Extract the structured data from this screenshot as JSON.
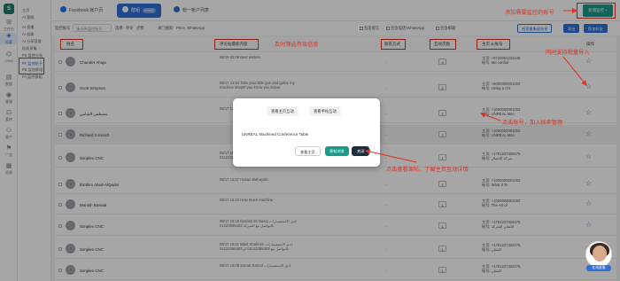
{
  "iconbar": {
    "logo_text": "S",
    "items": [
      {
        "glyph": "⊞",
        "label": "工作台"
      },
      {
        "glyph": "◈",
        "label": "拓客"
      },
      {
        "glyph": "⌬",
        "label": "CRM"
      },
      {
        "glyph": "▤",
        "label": "数据"
      },
      {
        "glyph": "◉",
        "label": "客服"
      },
      {
        "glyph": "⊡",
        "label": "素材"
      },
      {
        "glyph": "⚇",
        "label": "客户"
      },
      {
        "glyph": "⚑",
        "label": "广告"
      },
      {
        "glyph": "▦",
        "label": "资源"
      }
    ]
  },
  "subnav": {
    "items": [
      "主页",
      "AI 客服",
      "AI 直播",
      "AI 创建",
      "AI 分享获客",
      "挂机采集",
      "FB 监控分析",
      "FF 监控帖子",
      "FB 监控群组",
      "FA 监控群组"
    ]
  },
  "topbar": {
    "tabs": [
      {
        "label": "Facebook 帐户页",
        "color": "#1877f2",
        "badge": ""
      },
      {
        "label": "群组",
        "color": "#ffffff",
        "badge": "49897"
      },
      {
        "label": "粉一帐户列表",
        "color": "#2f6fd7",
        "badge": ""
      }
    ],
    "add_monitor": "新增监控 +"
  },
  "filterbar": {
    "label_account": "监控账号",
    "search_placeholder": "请选择监控账号",
    "tag1": "选择",
    "tag2": "评论",
    "tag3": "点赞",
    "label_keyword": "关门搜索",
    "keyword_value": "Price, WhatsApp",
    "check1": "包含留言",
    "check2": "包含电话/WhatsApp",
    "check3": "包含邮箱",
    "btn_collect": "线索量集成结果",
    "btn_export": "导出",
    "btn_batch": "群加好友"
  },
  "table": {
    "headers": [
      "姓名",
      "评论帖最新内容",
      "联系方式",
      "互动次数",
      "主页 & 帐号",
      "操作"
    ],
    "rows": [
      {
        "name": "Chander Ahuja",
        "time": "08/19 02:09 Best wishes",
        "contact": "-",
        "count": "3",
        "phone": "主页: +9720051332248\n帐号: Me.cordial",
        "grey": false
      },
      {
        "name": "Scott Simpson",
        "time": "08/17 21:53 Take your little gun and go!be my machine shop!If you know you know!",
        "contact": "-",
        "count": "2",
        "phone": "主页: +6000000001002\n帐号: Using a CN",
        "grey": false
      },
      {
        "name": "مصطفى الشامي",
        "time": "08/17 17:12 شكرا مساعدة للتعاون",
        "contact": "-",
        "count": "1",
        "phone": "主页: +1000000001002\n帐号: UNREAL Man",
        "grey": false
      },
      {
        "name": "Richard S Kirsch",
        "time": "",
        "contact": "-",
        "count": "2",
        "phone": "主页: +1000000001002\n帐号: UNREAL Man",
        "grey": true
      },
      {
        "name": "Simplex CNC",
        "time": "08/17 15:11 للاتصال\n01123355403 او 01223355403",
        "contact": "-",
        "count": "1",
        "phone": "主页: +1751227326475\n帐号: شركه الاتصال",
        "grey": false
      },
      {
        "name": "Ibrahim Abed-AlQader",
        "time": "08/17 15:07 Hasan Mahuydin",
        "contact": "-",
        "count": "1",
        "phone": "主页: +1000000001002\n帐号: What It To",
        "grey": false
      },
      {
        "name": "Manish Baswal",
        "time": "08/17 15:15 How much machine",
        "contact": "-",
        "count": "1",
        "phone": "主页: +1000000001002\n帐号: The Art of",
        "grey": false
      },
      {
        "name": "Simplex CNC",
        "time": "08/17 15:10 Ibrahim El-masry لدي الاستفسارات بالتواصل مع الشركة 01223355403",
        "contact": "-",
        "count": "1",
        "phone": "主页: +1751227326475\n帐号: اللتقان الشركة",
        "grey": false
      },
      {
        "name": "Simplex CNC",
        "time": "08/17 15:11 Wael Shaheen لدي الاستفسارات بالتواصل مع 01123355403 او 01223355403",
        "contact": "-",
        "count": "1",
        "phone": "主页: +1751227326475\n帐号: اللتقان",
        "grey": false
      },
      {
        "name": "Simplex CNC",
        "time": "08/17 15:08 Samar Kamal لدي الاستفسارات",
        "contact": "-",
        "count": "1",
        "phone": "主页: +1751227326475\n帐号: اللتقان",
        "grey": false
      }
    ]
  },
  "modal": {
    "tab1": "查看主页互动",
    "tab2": "查看手帖互动",
    "desc": "UNREAL Machined Conference Table",
    "btn_home": "查看主页",
    "btn_post": "原帖浏览",
    "btn_close": "关闭"
  },
  "annotations": {
    "add_account": "添加需要监控的账号",
    "realtime": "及时筛选有效信息",
    "batch": "同时支持批量导入",
    "click_account": "点击账号，加入线索管理",
    "view_post": "点击查看源帖，了解主页互动详情"
  },
  "assistant": {
    "label": "在线客服"
  },
  "colors": {
    "primary": "#2f6fd7",
    "teal": "#1a9a8a",
    "annotation": "#e2301e",
    "dark_button": "#1b2f3e"
  }
}
